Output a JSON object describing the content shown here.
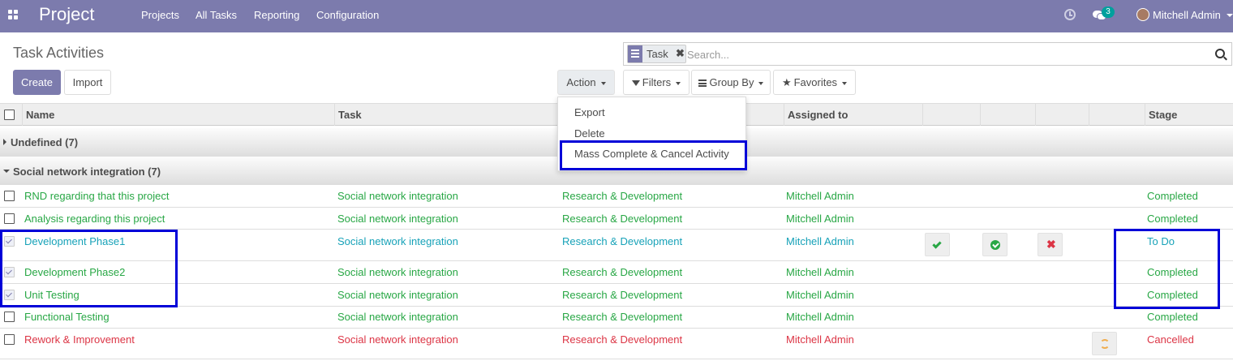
{
  "navbar": {
    "app_title": "Project",
    "menu": [
      "Projects",
      "All Tasks",
      "Reporting",
      "Configuration"
    ],
    "chat_count": "3",
    "user_name": "Mitchell Admin",
    "bg_color": "#7c7bad"
  },
  "control_panel": {
    "title": "Task Activities",
    "create_label": "Create",
    "import_label": "Import",
    "action_label": "Action",
    "filters_label": "Filters",
    "group_by_label": "Group By",
    "favorites_label": "Favorites",
    "search": {
      "facet_value": "Task",
      "placeholder": "Search..."
    }
  },
  "action_menu": {
    "items": [
      "Export",
      "Delete",
      "Mass Complete & Cancel Activity"
    ]
  },
  "table": {
    "headers": [
      "Name",
      "Task",
      "Assigned to",
      "Stage"
    ],
    "groups": [
      {
        "label": "Undefined (7)",
        "expanded": false
      },
      {
        "label": "Social network integration (7)",
        "expanded": true
      }
    ],
    "rows": [
      {
        "checked": false,
        "name": "RND regarding that this project",
        "task": "Social network integration",
        "project": "Research & Development",
        "assigned": "Mitchell Admin",
        "stage": "Completed",
        "status": "success"
      },
      {
        "checked": false,
        "name": "Analysis regarding this project",
        "task": "Social network integration",
        "project": "Research & Development",
        "assigned": "Mitchell Admin",
        "stage": "Completed",
        "status": "success"
      },
      {
        "checked": true,
        "name": "Development Phase1",
        "task": "Social network integration",
        "project": "Research & Development",
        "assigned": "Mitchell Admin",
        "stage": "To Do",
        "status": "info"
      },
      {
        "checked": true,
        "name": "Development Phase2",
        "task": "Social network integration",
        "project": "Research & Development",
        "assigned": "Mitchell Admin",
        "stage": "Completed",
        "status": "success"
      },
      {
        "checked": true,
        "name": "Unit Testing",
        "task": "Social network integration",
        "project": "Research & Development",
        "assigned": "Mitchell Admin",
        "stage": "Completed",
        "status": "success"
      },
      {
        "checked": false,
        "name": "Functional Testing",
        "task": "Social network integration",
        "project": "Research & Development",
        "assigned": "Mitchell Admin",
        "stage": "Completed",
        "status": "success"
      },
      {
        "checked": false,
        "name": "Rework & Improvement",
        "task": "Social network integration",
        "project": "Research & Development",
        "assigned": "Mitchell Admin",
        "stage": "Cancelled",
        "status": "danger"
      }
    ]
  },
  "colors": {
    "success": "#28a745",
    "info": "#17a2b8",
    "danger": "#dc3545",
    "highlight": "#0000d8"
  }
}
